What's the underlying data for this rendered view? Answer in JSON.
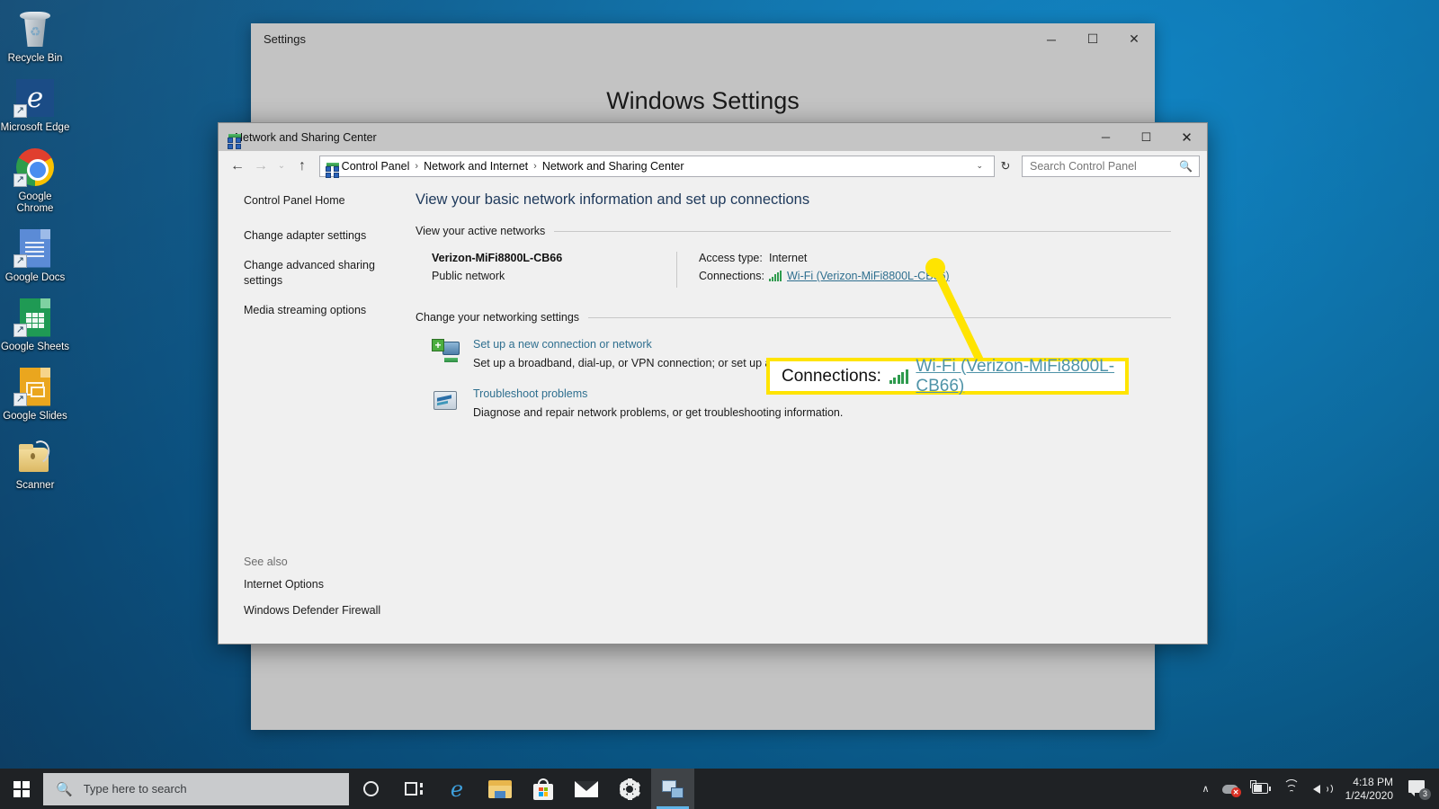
{
  "desktop": {
    "icons": [
      {
        "label": "Recycle Bin",
        "icon": "recycle-bin-icon"
      },
      {
        "label": "Microsoft Edge",
        "icon": "edge-icon"
      },
      {
        "label": "Google Chrome",
        "icon": "chrome-icon"
      },
      {
        "label": "Google Docs",
        "icon": "google-docs-icon"
      },
      {
        "label": "Google Sheets",
        "icon": "google-sheets-icon"
      },
      {
        "label": "Google Slides",
        "icon": "google-slides-icon"
      },
      {
        "label": "Scanner",
        "icon": "scanner-icon"
      }
    ]
  },
  "settings_window": {
    "title": "Settings",
    "heading": "Windows Settings",
    "minimize": "─",
    "maximize": "☐",
    "close": "✕"
  },
  "nsc_window": {
    "title": "Network and Sharing Center",
    "minimize": "─",
    "maximize": "☐",
    "close": "✕",
    "address": {
      "back": "←",
      "forward": "→",
      "recent": "⌄",
      "up": "↑",
      "breadcrumbs": [
        "Control Panel",
        "Network and Internet",
        "Network and Sharing Center"
      ],
      "separator": "›",
      "dropdown": "⌄",
      "refresh": "↻",
      "search_placeholder": "Search Control Panel",
      "search_value": ""
    },
    "sidebar": {
      "items": [
        "Control Panel Home",
        "Change adapter settings",
        "Change advanced sharing settings",
        "Media streaming options"
      ],
      "see_also_title": "See also",
      "see_also": [
        "Internet Options",
        "Windows Defender Firewall"
      ]
    },
    "main": {
      "heading": "View your basic network information and set up connections",
      "active_networks_title": "View your active networks",
      "network": {
        "name": "Verizon-MiFi8800L-CB66",
        "type": "Public network",
        "access_type_label": "Access type:",
        "access_type_value": "Internet",
        "connections_label": "Connections:",
        "connections_link": "Wi-Fi (Verizon-MiFi8800L-CB66)"
      },
      "change_settings_title": "Change your networking settings",
      "settings_items": [
        {
          "icon": "new-connection-icon",
          "link": "Set up a new connection or network",
          "desc": "Set up a broadband, dial-up, or VPN connection; or set up a router or access point."
        },
        {
          "icon": "troubleshoot-icon",
          "link": "Troubleshoot problems",
          "desc": "Diagnose and repair network problems, or get troubleshooting information."
        }
      ]
    }
  },
  "callout": {
    "label": "Connections:",
    "link": "Wi-Fi (Verizon-MiFi8800L-CB66)",
    "border_color": "#ffe400",
    "fill_color": "#ffffff"
  },
  "taskbar": {
    "start": "start-button",
    "search_placeholder": "Type here to search",
    "buttons": [
      {
        "name": "cortana-button",
        "icon": "cortana-circle-icon"
      },
      {
        "name": "task-view-button",
        "icon": "task-view-icon"
      },
      {
        "name": "edge-taskbar-button",
        "icon": "edge-icon"
      },
      {
        "name": "file-explorer-button",
        "icon": "folder-icon"
      },
      {
        "name": "microsoft-store-button",
        "icon": "store-bag-icon"
      },
      {
        "name": "mail-button",
        "icon": "mail-envelope-icon"
      },
      {
        "name": "settings-button",
        "icon": "gear-icon"
      },
      {
        "name": "network-sharing-center-button",
        "icon": "network-sharing-icon"
      }
    ],
    "tray": {
      "chevron": "∧",
      "time": "4:18 PM",
      "date": "1/24/2020",
      "notification_count": "3"
    }
  }
}
